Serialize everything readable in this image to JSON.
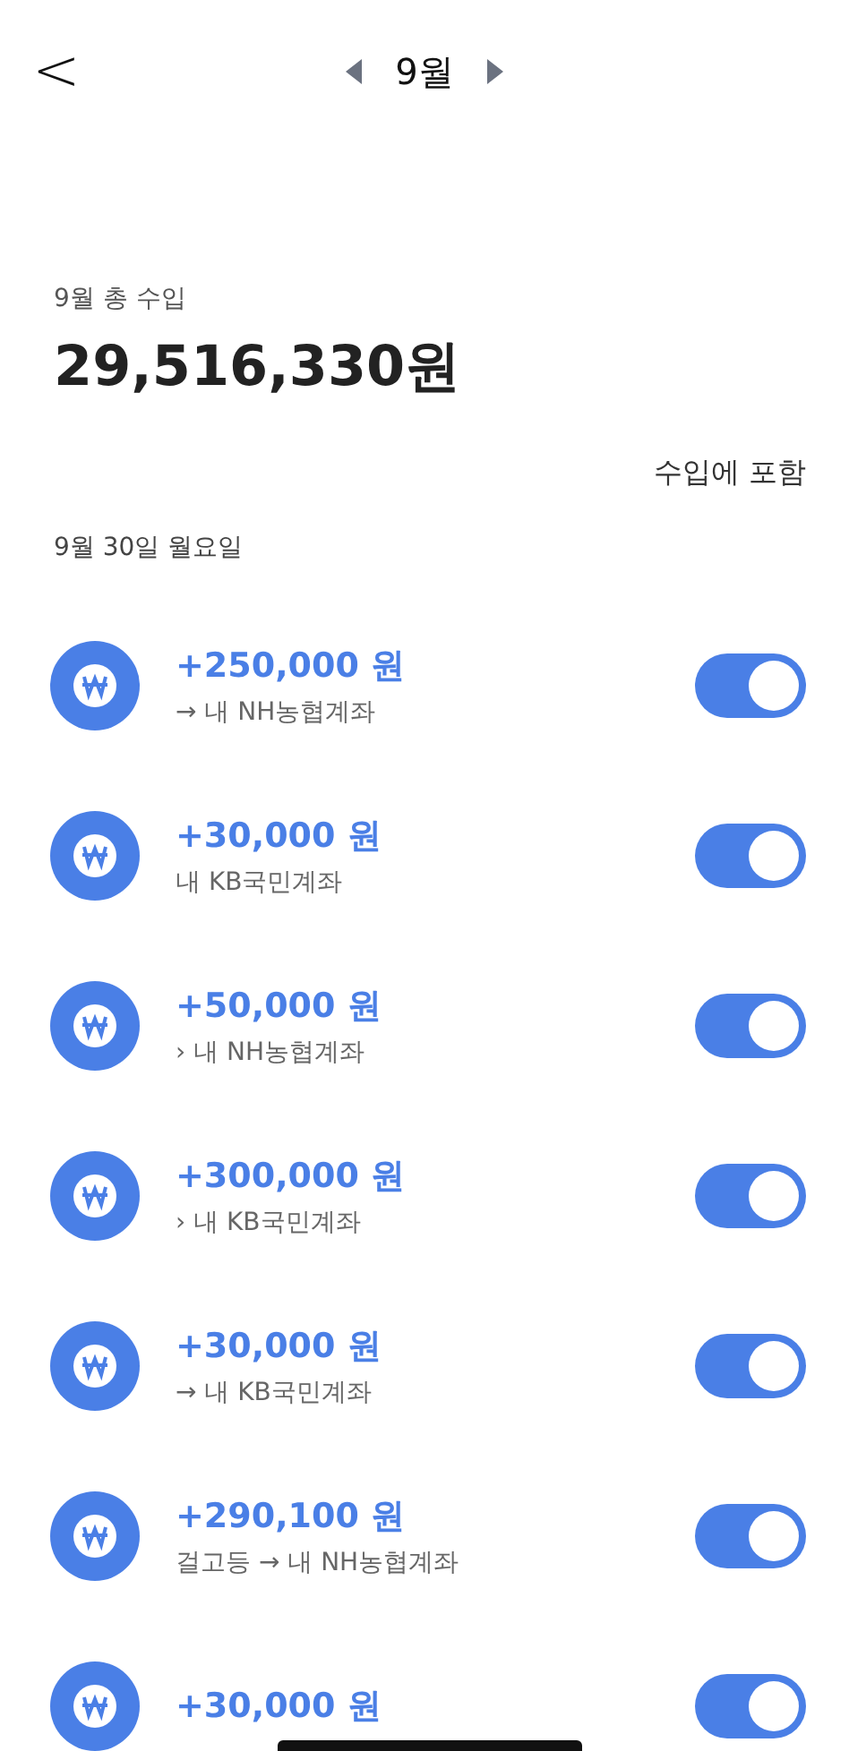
{
  "header": {
    "back": "<",
    "month": "9월"
  },
  "summary": {
    "label": "9월 총 수입",
    "total": "29,516,330원"
  },
  "column_header": "수입에 포함",
  "date": "9월 30일 월요일",
  "transactions": [
    {
      "amount": "+250,000 원",
      "detail": "→ 내 NH농협계좌",
      "on": true
    },
    {
      "amount": "+30,000 원",
      "detail": "내 KB국민계좌",
      "on": true
    },
    {
      "amount": "+50,000 원",
      "detail": "› 내 NH농협계좌",
      "on": true
    },
    {
      "amount": "+300,000 원",
      "detail": "› 내 KB국민계좌",
      "on": true
    },
    {
      "amount": "+30,000 원",
      "detail": "→ 내 KB국민계좌",
      "on": true
    },
    {
      "amount": "+290,100 원",
      "detail": "걸고등 → 내 NH농협계좌",
      "on": true
    },
    {
      "amount": "+30,000 원",
      "on": true
    }
  ]
}
